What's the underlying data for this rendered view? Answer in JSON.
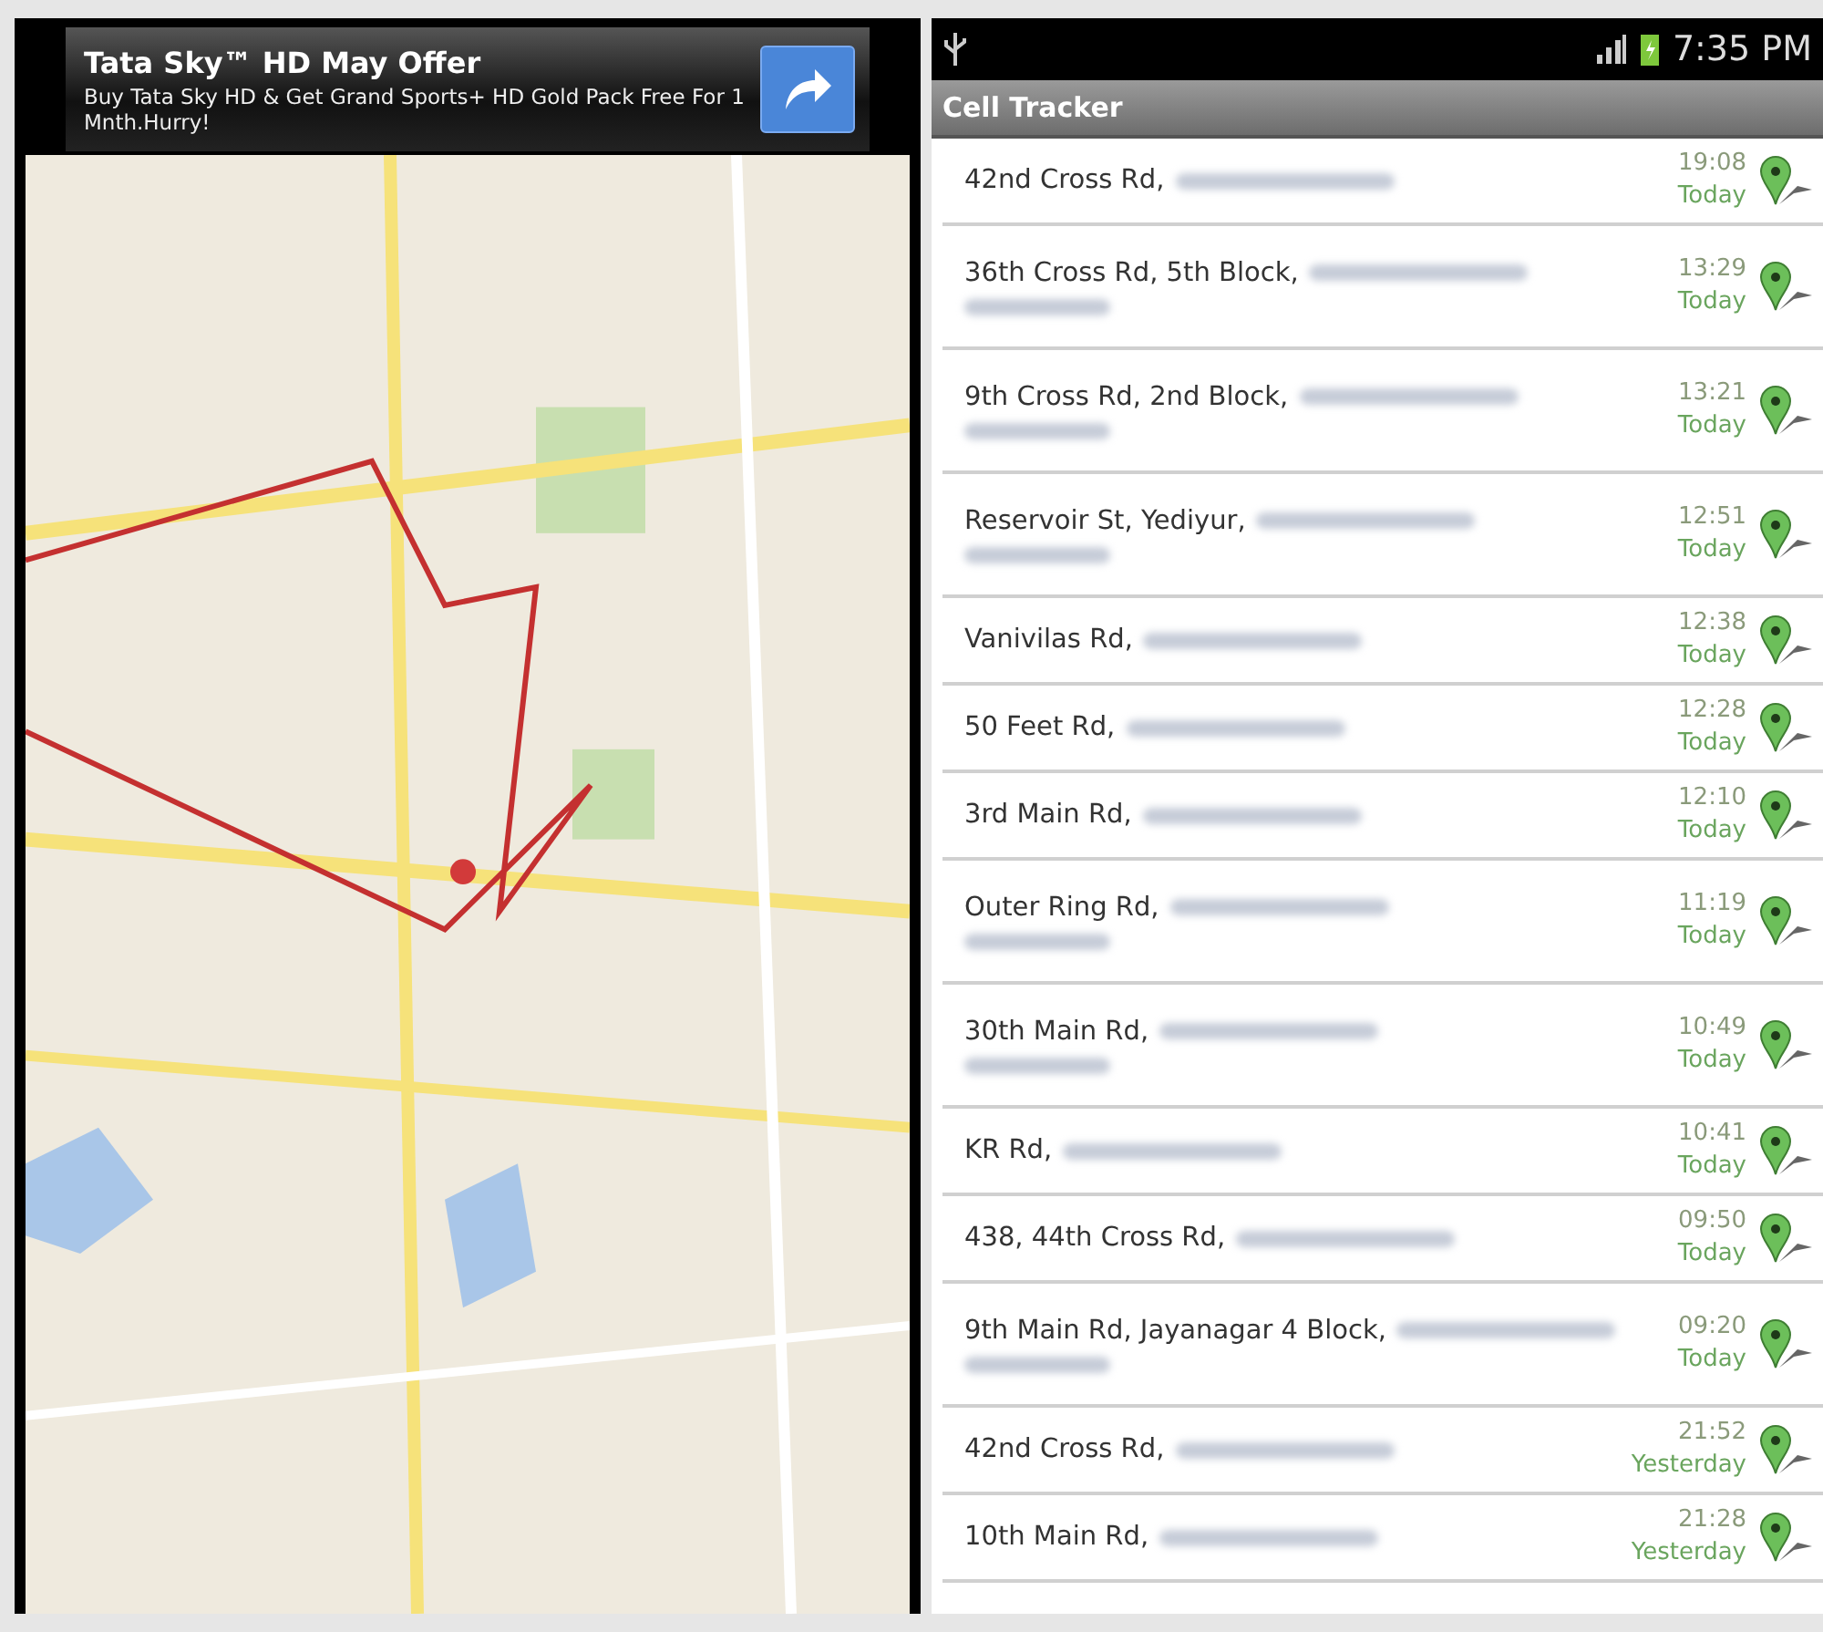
{
  "ad_banner": {
    "title": "Tata Sky™ HD May Offer",
    "text": "Buy Tata Sky HD & Get Grand Sports+ HD Gold Pack Free For 1 Mnth.Hurry!"
  },
  "status_bar": {
    "time": "7:35 PM"
  },
  "app_bar": {
    "title": "Cell Tracker"
  },
  "locations": [
    {
      "address": "42nd Cross Rd,",
      "redacted_line": false,
      "time": "19:08",
      "day": "Today"
    },
    {
      "address": "36th Cross Rd, 5th Block,",
      "redacted_line": true,
      "time": "13:29",
      "day": "Today"
    },
    {
      "address": "9th Cross Rd, 2nd Block,",
      "redacted_line": true,
      "time": "13:21",
      "day": "Today"
    },
    {
      "address": "Reservoir St, Yediyur,",
      "redacted_line": true,
      "time": "12:51",
      "day": "Today"
    },
    {
      "address": "Vanivilas Rd,",
      "redacted_line": false,
      "time": "12:38",
      "day": "Today"
    },
    {
      "address": "50 Feet Rd,",
      "redacted_line": false,
      "time": "12:28",
      "day": "Today"
    },
    {
      "address": "3rd Main Rd,",
      "redacted_line": false,
      "time": "12:10",
      "day": "Today"
    },
    {
      "address": "Outer Ring Rd,",
      "redacted_line": true,
      "time": "11:19",
      "day": "Today"
    },
    {
      "address": "30th Main Rd,",
      "redacted_line": true,
      "time": "10:49",
      "day": "Today"
    },
    {
      "address": "KR Rd,",
      "redacted_line": false,
      "time": "10:41",
      "day": "Today"
    },
    {
      "address": "438, 44th Cross Rd,",
      "redacted_line": false,
      "time": "09:50",
      "day": "Today"
    },
    {
      "address": "9th Main Rd, Jayanagar 4 Block,",
      "redacted_line": true,
      "time": "09:20",
      "day": "Today"
    },
    {
      "address": "42nd Cross Rd,",
      "redacted_line": false,
      "time": "21:52",
      "day": "Yesterday"
    },
    {
      "address": "10th Main Rd,",
      "redacted_line": false,
      "time": "21:28",
      "day": "Yesterday"
    }
  ]
}
